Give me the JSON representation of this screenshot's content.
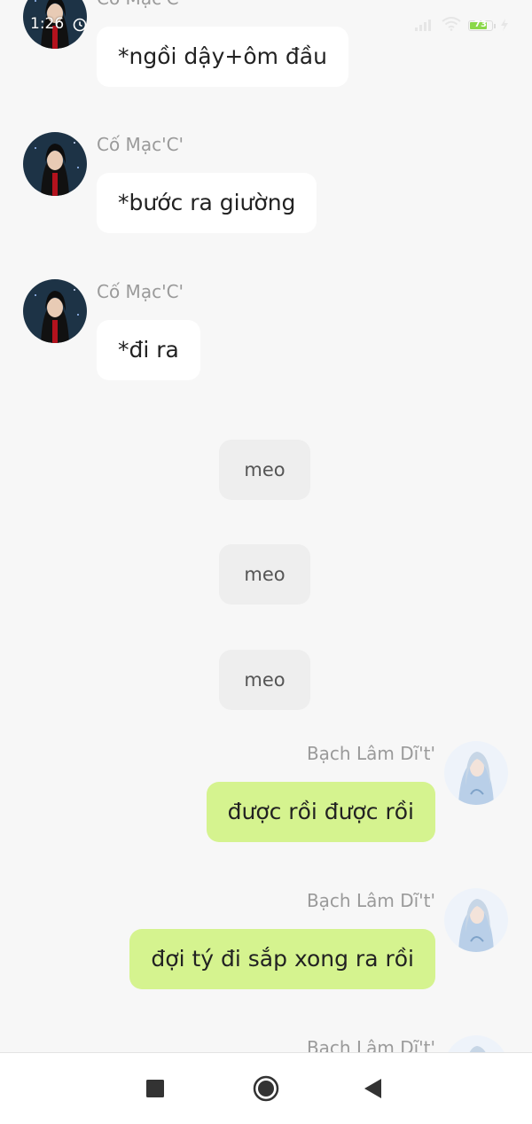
{
  "status_bar": {
    "time": "1:26",
    "battery_level": "73",
    "icons": [
      "alarm-icon",
      "signal-icon",
      "wifi-icon",
      "battery-icon",
      "charging-icon"
    ]
  },
  "colors": {
    "background": "#f7f7f7",
    "incoming_bubble": "#ffffff",
    "outgoing_bubble": "#d5f38f",
    "system_chip": "#eeeeee",
    "sender_name": "#9a9a9a"
  },
  "messages": [
    {
      "direction": "incoming",
      "sender": "Cố Mạc'C'",
      "text": "*ngồi dậy+ôm đầu"
    },
    {
      "direction": "incoming",
      "sender": "Cố Mạc'C'",
      "text": "*bước ra giường"
    },
    {
      "direction": "incoming",
      "sender": "Cố Mạc'C'",
      "text": "*đi ra"
    },
    {
      "direction": "system",
      "text": "meo"
    },
    {
      "direction": "system",
      "text": "meo"
    },
    {
      "direction": "system",
      "text": "meo"
    },
    {
      "direction": "outgoing",
      "sender": "Bạch Lâm Dĩ't'",
      "text": "được rồi được rồi"
    },
    {
      "direction": "outgoing",
      "sender": "Bạch Lâm Dĩ't'",
      "text": "đợi tý đi sắp xong ra rồi"
    },
    {
      "direction": "outgoing",
      "sender": "Bạch Lâm Dĩ't'",
      "text": ""
    }
  ],
  "nav_bar": {
    "buttons": [
      "recents-square-icon",
      "home-circle-icon",
      "back-triangle-icon"
    ]
  }
}
